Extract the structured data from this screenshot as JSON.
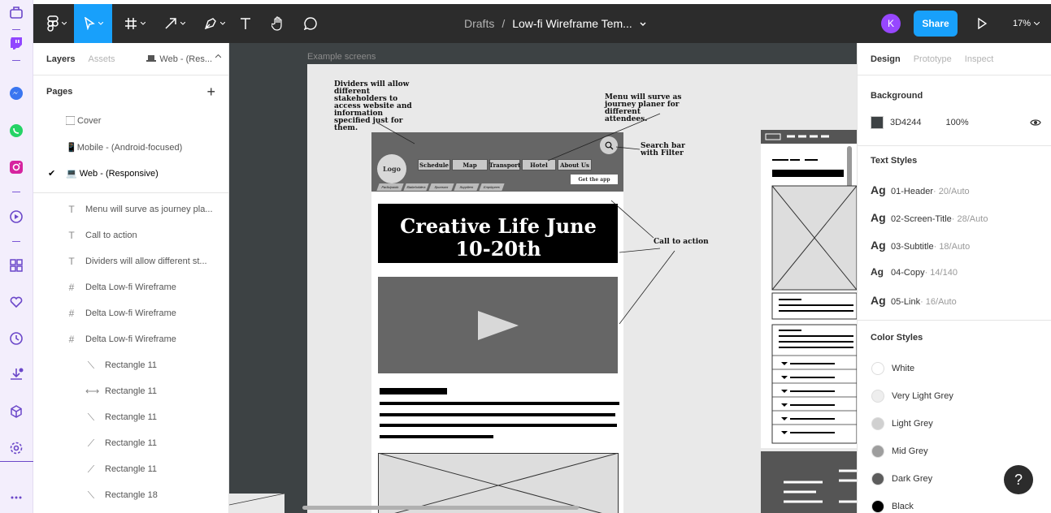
{
  "toolbar": {
    "breadcrumb_root": "Drafts",
    "breadcrumb_sep": "/",
    "file_name": "Low-fi Wireframe Tem...",
    "avatar_initial": "K",
    "share_label": "Share",
    "zoom": "17%"
  },
  "left_panel": {
    "tabs": [
      "Layers",
      "Assets"
    ],
    "page_switch": "Web - (Res...",
    "pages_title": "Pages",
    "pages": [
      {
        "label": "🏻 Cover"
      },
      {
        "label": "📱Mobile - (Android-focused)"
      },
      {
        "label": "💻 Web - (Responsive)"
      }
    ],
    "layers": [
      {
        "label": "Menu will surve as journey pla..."
      },
      {
        "label": "Call to action"
      },
      {
        "label": "Dividers will allow different st..."
      },
      {
        "label": "Delta Low-fi Wireframe"
      },
      {
        "label": "Delta Low-fi Wireframe"
      },
      {
        "label": "Delta Low-fi Wireframe"
      },
      {
        "label": "Rectangle 11"
      },
      {
        "label": "Rectangle 11"
      },
      {
        "label": "Rectangle 11"
      },
      {
        "label": "Rectangle 11"
      },
      {
        "label": "Rectangle 11"
      },
      {
        "label": "Rectangle 18"
      }
    ]
  },
  "canvas": {
    "frame_label": "Example screens",
    "annotations": {
      "dividers": "Dividers will allow different stakeholders to access website and information specified just for them.",
      "menu": "Menu will surve as journey planer for different attendees.",
      "search": "Search bar with Filter",
      "cta": "Call to action"
    },
    "mini_tabs": [
      "Participants",
      "Stakeholders",
      "Sponsors",
      "Suppliers",
      "Employees"
    ],
    "logo": "Logo",
    "nav": [
      "Schedule",
      "Map",
      "Transport",
      "Hotel",
      "About Us"
    ],
    "get_app": "Get the app",
    "hero_title": "Creative Life June 10-20th"
  },
  "right_panel": {
    "tabs": [
      "Design",
      "Prototype",
      "Inspect"
    ],
    "background_title": "Background",
    "background_hex": "3D4244",
    "background_opacity": "100%",
    "text_styles_title": "Text Styles",
    "text_styles": [
      {
        "ag": "Ag",
        "name": "01-Header",
        "meta": " · 20/Auto"
      },
      {
        "ag": "Ag",
        "name": "02-Screen-Title",
        "meta": " · 28/Auto"
      },
      {
        "ag": "Ag",
        "name": "03-Subtitle",
        "meta": " · 18/Auto"
      },
      {
        "ag": "Ag",
        "name": "04-Copy",
        "meta": " · 14/140"
      },
      {
        "ag": "Ag",
        "name": "05-Link",
        "meta": " · 16/Auto"
      }
    ],
    "color_styles_title": "Color Styles",
    "color_styles": [
      {
        "name": "White",
        "color": "#ffffff"
      },
      {
        "name": "Very Light Grey",
        "color": "#eeeeee"
      },
      {
        "name": "Light Grey",
        "color": "#d0d0d0"
      },
      {
        "name": "Mid Grey",
        "color": "#9e9e9e"
      },
      {
        "name": "Dark Grey",
        "color": "#5c5c5c"
      },
      {
        "name": "Black",
        "color": "#000000"
      }
    ]
  },
  "help": "?",
  "colors": {
    "accent": "#18a0fb",
    "toolbar": "#2c2c2c",
    "rail": "#f3eefc"
  }
}
